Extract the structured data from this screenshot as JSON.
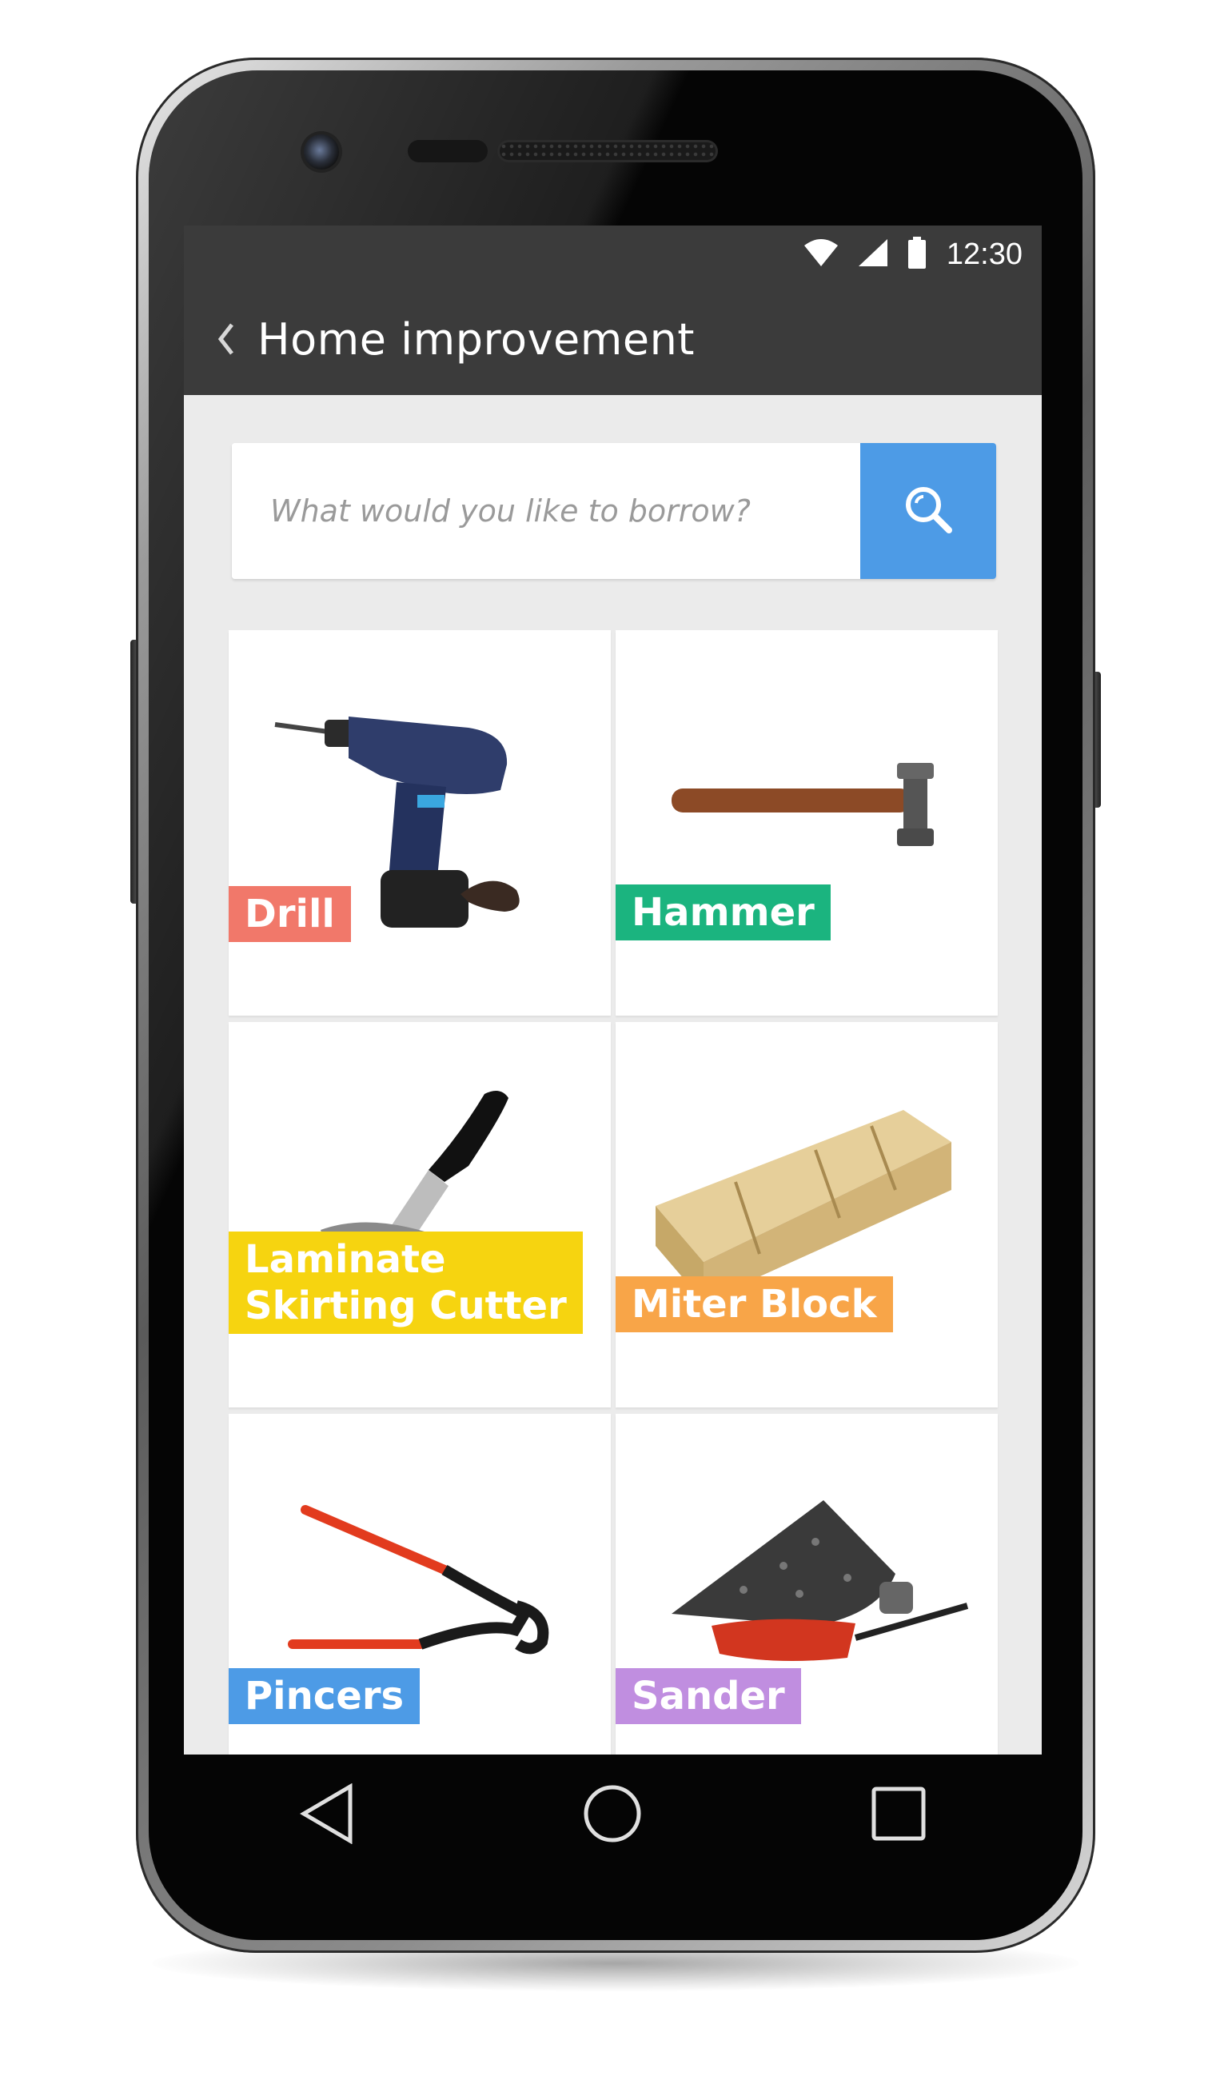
{
  "status_bar": {
    "time": "12:30"
  },
  "app_bar": {
    "title": "Home improvement"
  },
  "search": {
    "placeholder": "What would you like to borrow?"
  },
  "colors": {
    "app_bar": "#3b3b3b",
    "search_button": "#4d9be6",
    "drill": "#f1786a",
    "hammer": "#1bb47f",
    "cutter": "#f6d410",
    "miter": "#f8a548",
    "pincers": "#4d9be6",
    "sander": "#c08ee0"
  },
  "items": [
    {
      "label": "Drill",
      "icon": "drill-icon"
    },
    {
      "label": "Hammer",
      "icon": "hammer-icon"
    },
    {
      "label": "Laminate\nSkirting Cutter",
      "icon": "cutter-icon"
    },
    {
      "label": "Miter Block",
      "icon": "miter-block-icon"
    },
    {
      "label": "Pincers",
      "icon": "pincers-icon"
    },
    {
      "label": "Sander",
      "icon": "sander-icon"
    }
  ],
  "nav": {
    "back": "back-triangle-icon",
    "home": "home-circle-icon",
    "recents": "recents-square-icon"
  }
}
